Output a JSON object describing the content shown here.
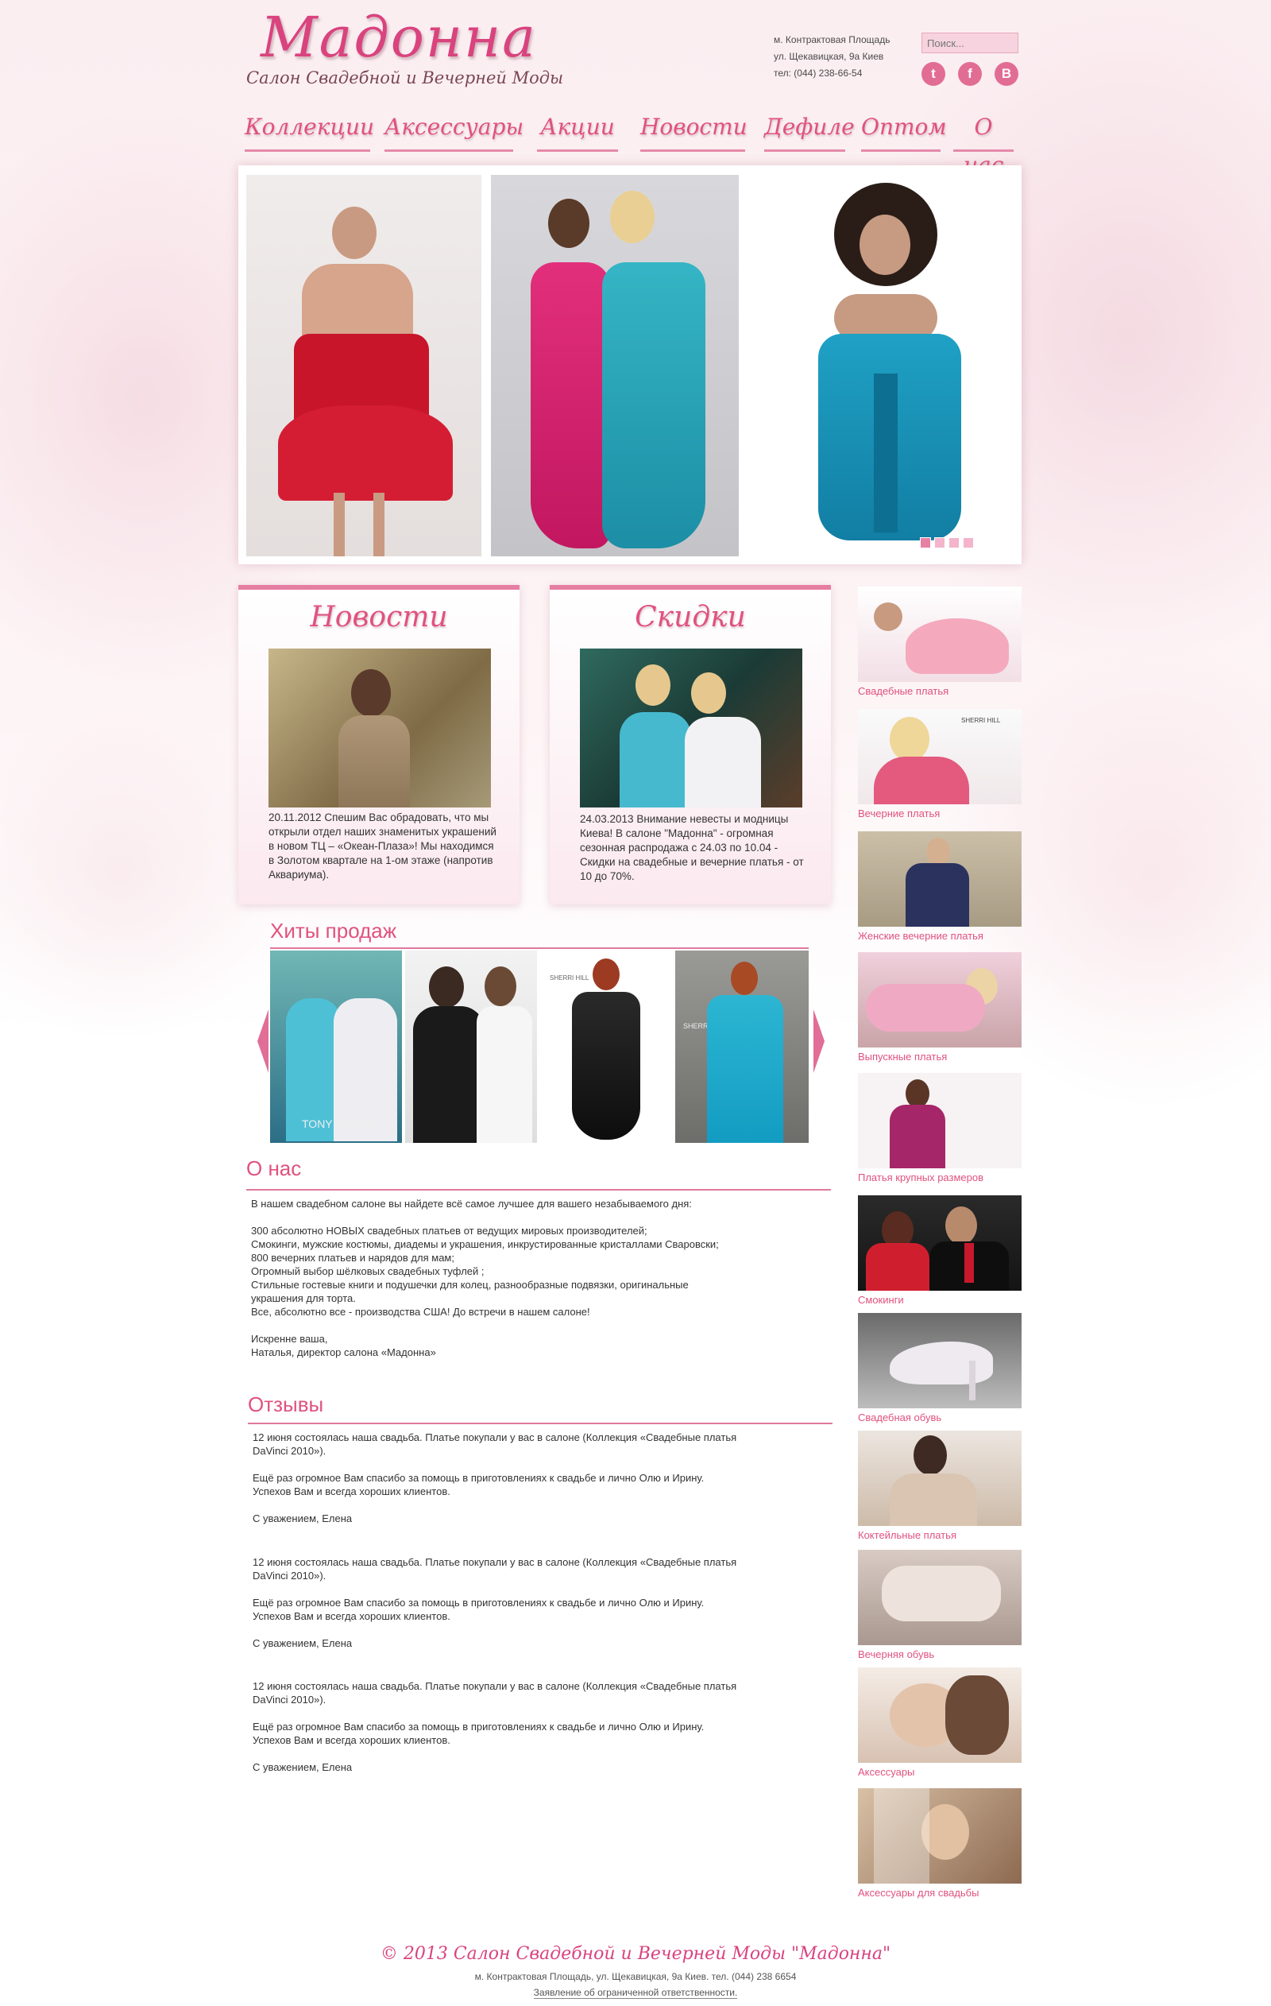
{
  "header": {
    "logo": "Мадонна",
    "tagline": "Салон Свадебной и Вечерней Моды",
    "address_line1": "м. Контрактовая Площадь",
    "address_line2": "ул. Щекавицкая, 9а Киев",
    "phone": "тел: (044) 238-66-54",
    "search_placeholder": "Поиск...",
    "social": [
      {
        "icon": "twitter-icon",
        "glyph": "t"
      },
      {
        "icon": "facebook-icon",
        "glyph": "f"
      },
      {
        "icon": "blogger-icon",
        "glyph": "B"
      }
    ]
  },
  "nav": [
    "Коллекции",
    "Аксессуары",
    "Акции",
    "Новости",
    "Дефиле",
    "Оптом",
    "О нас"
  ],
  "slider": {
    "slide_count": 4,
    "active_slide": 1
  },
  "news": {
    "title": "Новости",
    "text": "20.11.2012 Спешим Вас обрадовать, что мы открыли отдел наших знаменитых украшений в новом ТЦ – «Океан-Плаза»! Мы находимся  в Золотом квартале на 1-ом  этаже (напротив Аквариума)."
  },
  "discounts": {
    "title": "Скидки",
    "text": "24.03.2013 Внимание невесты и модницы Киева! В салоне \"Мадонна\" - огромная сезонная распродажа с 24.03 по 10.04 - Скидки на свадебные и вечерние платья - от 10 до 70%."
  },
  "hits": {
    "title": "Хиты продаж",
    "watermarks": [
      "TONY BOWLS",
      "",
      "SHERRI HILL",
      "SHERRI HILL"
    ]
  },
  "about": {
    "title": "О нас",
    "text": "В нашем свадебном салоне вы найдете всё самое лучшее для вашего незабываемого дня:\n\n300 абсолютно НОВЫХ свадебных платьев от ведущих мировых производителей;\nСмокинги, мужские костюмы, диадемы и украшения, инкрустированные кристаллами Сваровски;\n800 вечерних платьев и нарядов для мам;\nОгромный выбор шёлковых свадебных туфлей ;\nСтильные гостевые книги и подушечки для колец, разнообразные подвязки, оригинальные\nукрашения для торта.\nВсе, абсолютно все - производства США! До встречи в нашем салоне!\n\nИскренне ваша,\nНаталья, директор салона «Мадонна»"
  },
  "reviews": {
    "title": "Отзывы",
    "items": [
      "12 июня состоялась наша свадьба. Платье покупали у вас в салоне (Коллекция «Свадебные платья\nDaVinci 2010»).\n\nЕщё раз огромное Вам спасибо за помощь в приготовлениях к свадьбе и лично Олю и Ирину.\nУспехов Вам и всегда хороших клиентов.\n\nС уважением, Елена",
      "12 июня состоялась наша свадьба. Платье покупали у вас в салоне (Коллекция «Свадебные платья\nDaVinci 2010»).\n\nЕщё раз огромное Вам спасибо за помощь в приготовлениях к свадьбе и лично Олю и Ирину.\nУспехов Вам и всегда хороших клиентов.\n\nС уважением, Елена",
      "12 июня состоялась наша свадьба. Платье покупали у вас в салоне (Коллекция «Свадебные платья\nDaVinci 2010»).\n\nЕщё раз огромное Вам спасибо за помощь в приготовлениях к свадьбе и лично Олю и Ирину.\nУспехов Вам и всегда хороших клиентов.\n\nС уважением, Елена"
    ]
  },
  "categories": [
    {
      "label": "Свадебные платья",
      "color": "#f4b9c8",
      "watermark": ""
    },
    {
      "label": "Вечерние платья",
      "color": "#e46a8a",
      "watermark": "SHERRI HILL"
    },
    {
      "label": "Женские вечерние платья",
      "color": "#2f3560",
      "watermark": ""
    },
    {
      "label": "Выпускные платья",
      "color": "#e8a4bf",
      "watermark": ""
    },
    {
      "label": "Платья крупных размеров",
      "color": "#a6266a",
      "watermark": ""
    },
    {
      "label": "Смокинги",
      "color": "#c8192c",
      "watermark": ""
    },
    {
      "label": "Свадебная обувь",
      "color": "#8e8e8e",
      "watermark": ""
    },
    {
      "label": "Коктейльные платья",
      "color": "#c9b7a5",
      "watermark": ""
    },
    {
      "label": "Вечерняя обувь",
      "color": "#b9a8a0",
      "watermark": ""
    },
    {
      "label": "Аксессуары",
      "color": "#d8b8a8",
      "watermark": ""
    },
    {
      "label": "Аксессуары для свадьбы",
      "color": "#b08c70",
      "watermark": ""
    }
  ],
  "footer": {
    "copyright": "© 2013 Салон Свадебной и Вечерней Моды \"Мадонна\"",
    "address": "м. Контрактовая Площадь, ул. Щекавицкая, 9а Киев. тел. (044) 238 6654",
    "disclaimer": "Заявление об ограниченной ответственности."
  }
}
